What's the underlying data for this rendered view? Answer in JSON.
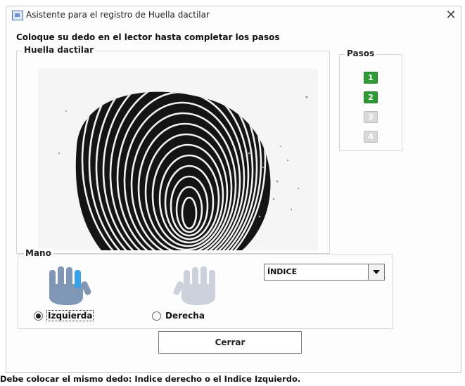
{
  "window": {
    "title": "Asistente para el registro de Huella dactilar",
    "close_glyph": "✕"
  },
  "instruction": "Coloque su dedo en el lector hasta completar los pasos",
  "fingerprint_panel": {
    "label": "Huella dactilar"
  },
  "steps_panel": {
    "label": "Pasos",
    "steps": [
      {
        "label": "1",
        "status": "done"
      },
      {
        "label": "2",
        "status": "done"
      },
      {
        "label": "3",
        "status": "pending"
      },
      {
        "label": "4",
        "status": "pending"
      }
    ]
  },
  "hand_panel": {
    "label": "Mano",
    "finger_select": {
      "value": "ÍNDICE"
    },
    "radios": [
      {
        "label": "Izquierda",
        "checked": true
      },
      {
        "label": "Derecha",
        "checked": false
      }
    ]
  },
  "buttons": {
    "close": "Cerrar"
  },
  "footer": "Debe colocar el mismo dedo: Indice derecho  o el Indice Izquierdo.",
  "colors": {
    "step_done": "#2f9a36",
    "step_pending": "#d9d9d9",
    "hand_active": "#7f97b4",
    "hand_inactive": "#cbd2db",
    "finger_highlight": "#3aa0e8"
  },
  "icons": {
    "title": "app-window-icon",
    "close": "close-icon",
    "left_hand": "left-hand-icon",
    "right_hand": "right-hand-icon",
    "dropdown": "chevron-down-icon"
  }
}
